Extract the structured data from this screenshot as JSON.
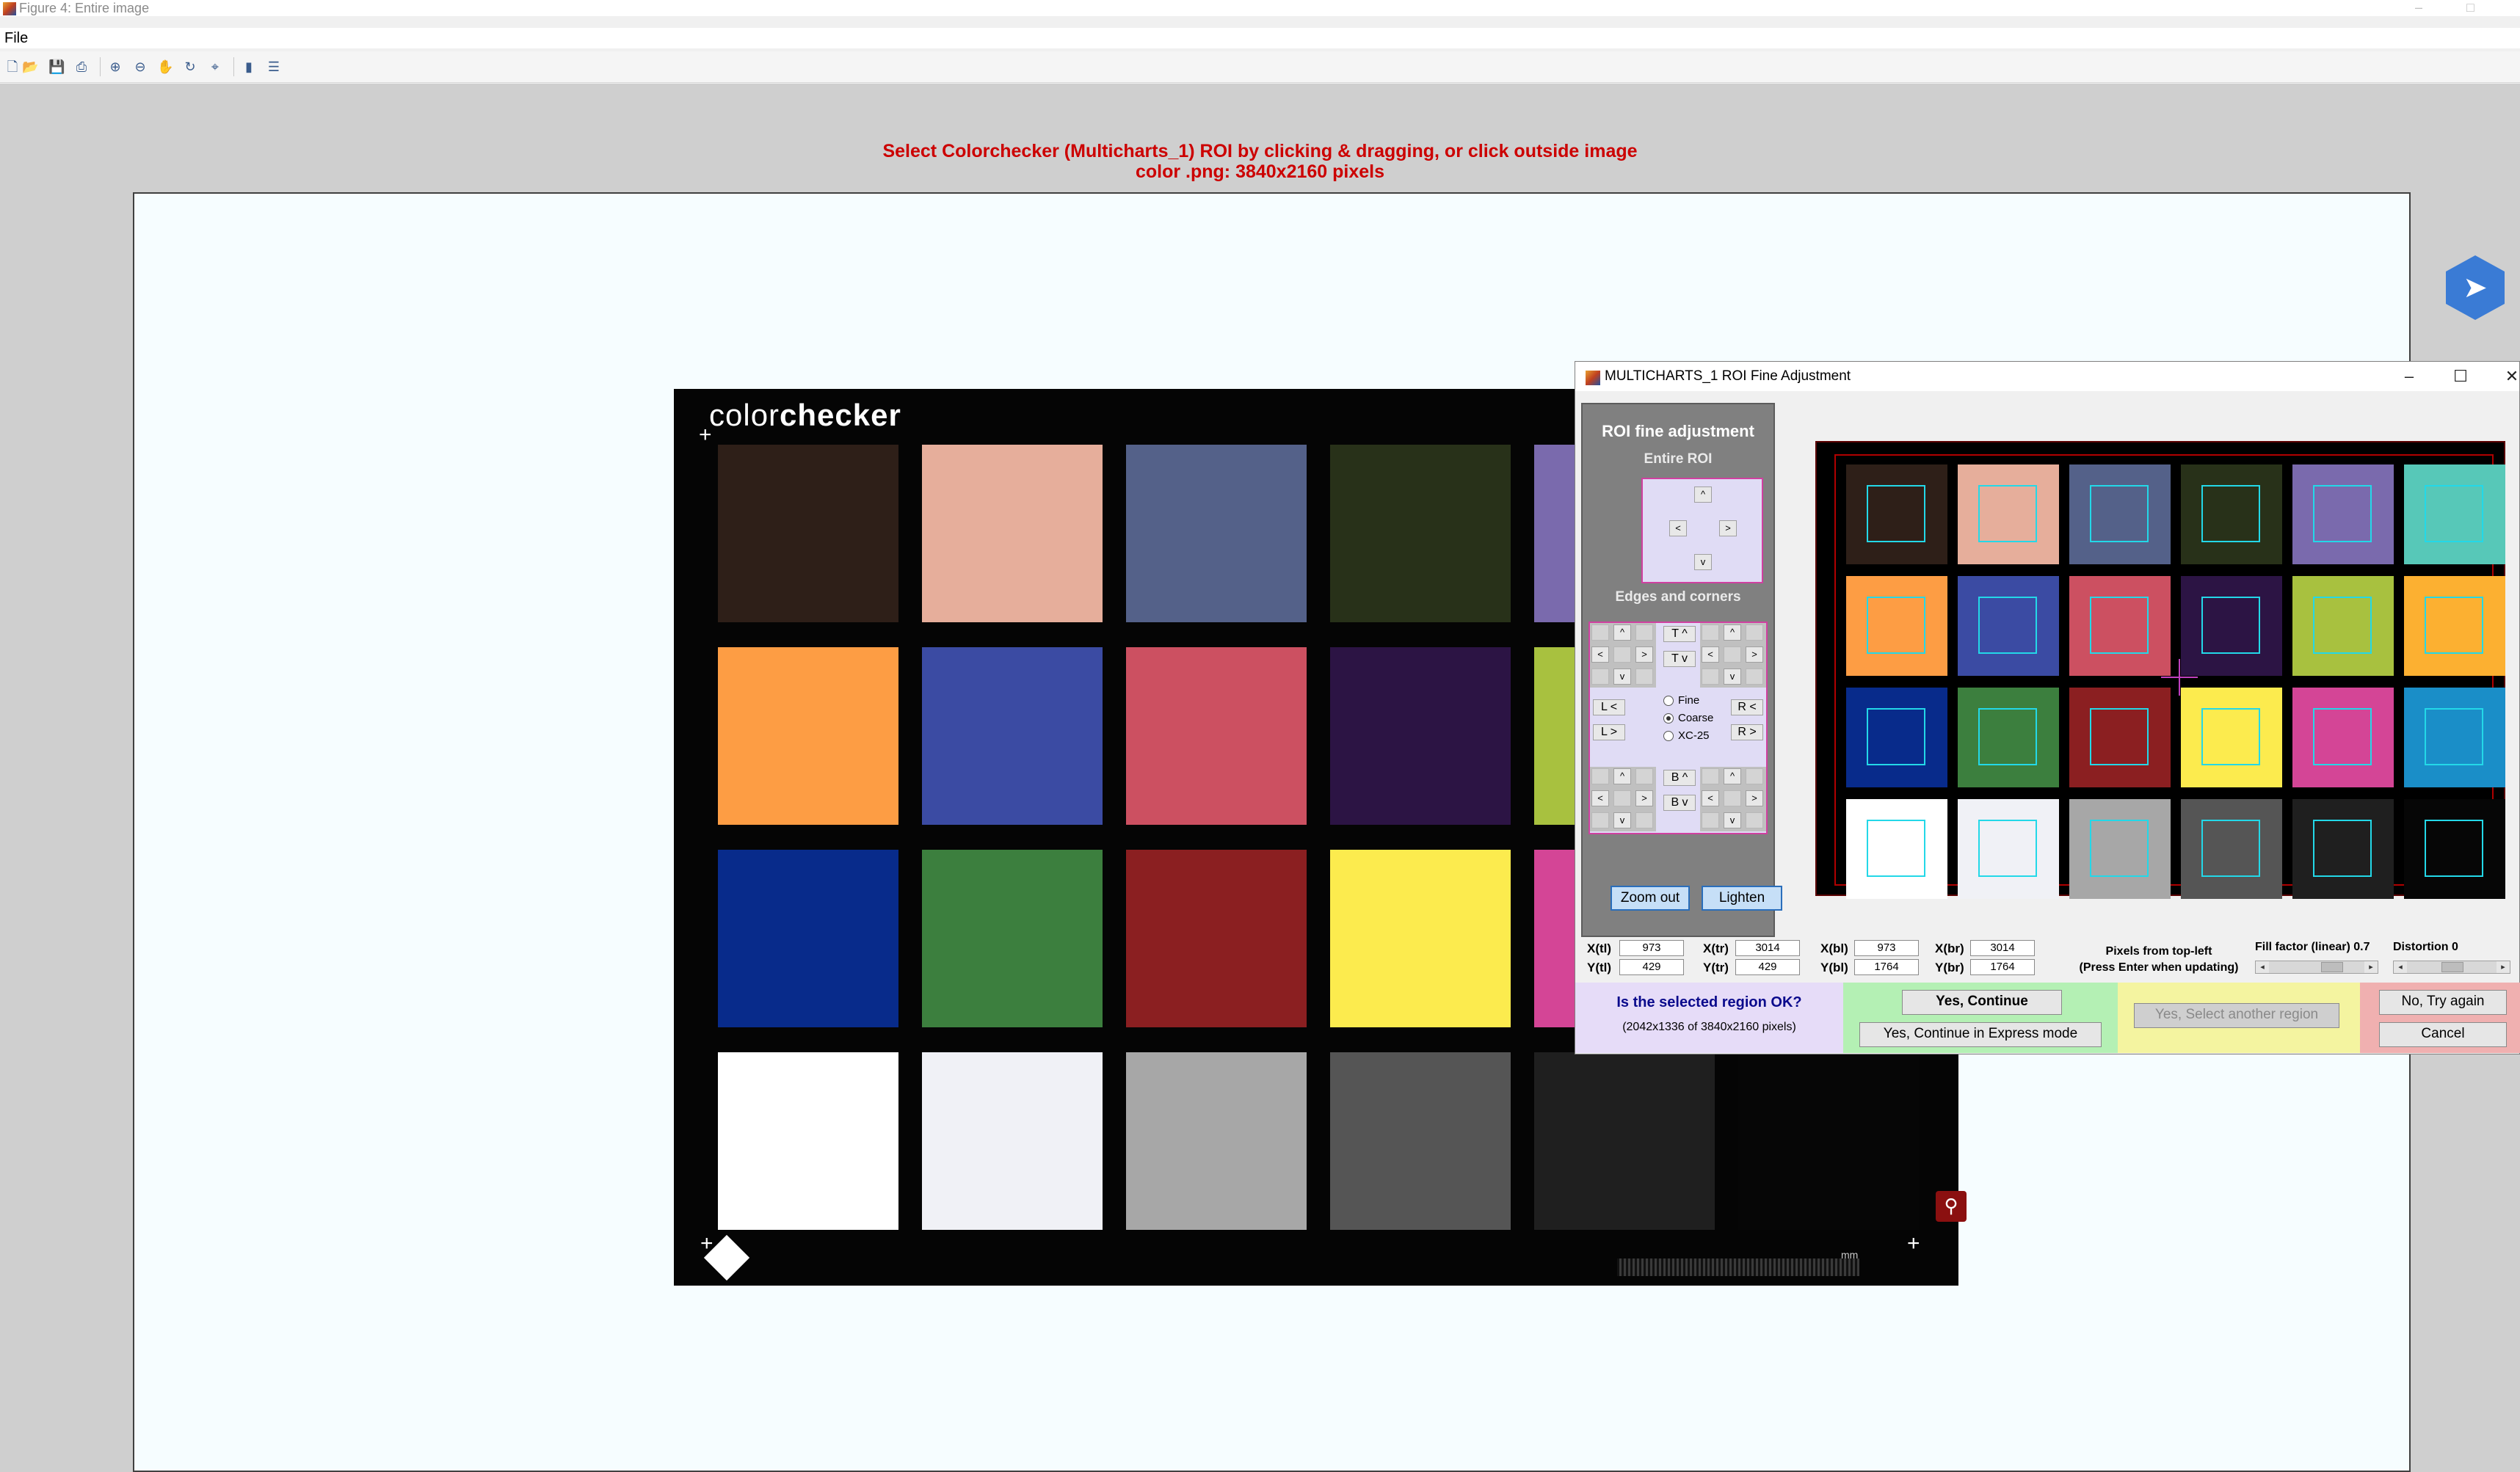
{
  "window": {
    "title": "Figure 4: Entire image",
    "controls": {
      "minimize": "–",
      "maximize": "□"
    }
  },
  "menubar": {
    "items": [
      {
        "label": "File"
      }
    ]
  },
  "toolbar": {
    "buttons": [
      {
        "name": "new-file-icon",
        "glyph": "🗋"
      },
      {
        "name": "open-folder-icon",
        "glyph": "📂"
      },
      {
        "name": "save-icon",
        "glyph": "💾"
      },
      {
        "name": "print-icon",
        "glyph": "⎙"
      },
      {
        "name": "zoom-in-icon",
        "glyph": "⊕"
      },
      {
        "name": "zoom-out-icon",
        "glyph": "⊖"
      },
      {
        "name": "pan-hand-icon",
        "glyph": "✋"
      },
      {
        "name": "rotate-icon",
        "glyph": "↻"
      },
      {
        "name": "data-cursor-icon",
        "glyph": "⌖"
      },
      {
        "name": "insert-colorbar-icon",
        "glyph": "▮"
      },
      {
        "name": "insert-legend-icon",
        "glyph": "☰"
      }
    ]
  },
  "prompt": {
    "line1": "Select Colorchecker (Multicharts_1) ROI by clicking & dragging, or click outside image",
    "line2": "color .png: 3840x2160 pixels"
  },
  "chart": {
    "title_prefix": "color",
    "title_bold": "checker",
    "mm_label": "mm",
    "patch_colors": [
      "#2e1f18",
      "#e6ae9b",
      "#546189",
      "#283119",
      "#7a6aad",
      "#57c8b8",
      "#fd9d44",
      "#3b4ba3",
      "#cc5061",
      "#2c1444",
      "#a8c13f",
      "#fcb031",
      "#082b8b",
      "#3c7f3e",
      "#8b1f21",
      "#fceb4e",
      "#d44596",
      "#1a8ec8",
      "#ffffff",
      "#f0f1f6",
      "#a7a7a7",
      "#555555",
      "#1f1f1f",
      "#060606"
    ]
  },
  "dialog": {
    "title": "MULTICHARTS_1 ROI Fine Adjustment",
    "controls": {
      "minimize": "–",
      "maximize": "☐",
      "close": "✕"
    },
    "panel": {
      "heading": "ROI fine adjustment",
      "entire_roi": "Entire ROI",
      "edges_corners": "Edges and corners",
      "up": "^",
      "down": "v",
      "left": "<",
      "right": ">",
      "top_up": "T ^",
      "top_down": "T v",
      "bottom_up": "B ^",
      "bottom_down": "B v",
      "left_left": "L <",
      "left_right": "L >",
      "right_left": "R <",
      "right_right": "R >",
      "modes": [
        {
          "label": "Fine",
          "selected": false
        },
        {
          "label": "Coarse",
          "selected": true
        },
        {
          "label": "XC-25",
          "selected": false
        }
      ],
      "zoom_out": "Zoom out",
      "lighten": "Lighten"
    },
    "coords": {
      "xtl_label": "X(tl)",
      "ytl_label": "Y(tl)",
      "xtr_label": "X(tr)",
      "ytr_label": "Y(tr)",
      "xbl_label": "X(bl)",
      "ybl_label": "Y(bl)",
      "xbr_label": "X(br)",
      "ybr_label": "Y(br)",
      "xtl": "973",
      "ytl": "429",
      "xtr": "3014",
      "ytr": "429",
      "xbl": "973",
      "ybl": "1764",
      "xbr": "3014",
      "ybr": "1764"
    },
    "pixels_note": {
      "line1": "Pixels from top-left",
      "line2": "(Press Enter when updating)"
    },
    "fill_factor": {
      "label": "Fill factor (linear) 0.7",
      "value": 0.7
    },
    "distortion": {
      "label": "Distortion 0",
      "value": 0
    },
    "confirm": {
      "question": "Is the selected region OK?",
      "detail": "(2042x1336 of 3840x2160 pixels)",
      "yes_continue": "Yes, Continue",
      "yes_express": "Yes, Continue in Express mode",
      "yes_select_another": "Yes, Select another region",
      "no_try_again": "No, Try again",
      "cancel": "Cancel"
    }
  }
}
